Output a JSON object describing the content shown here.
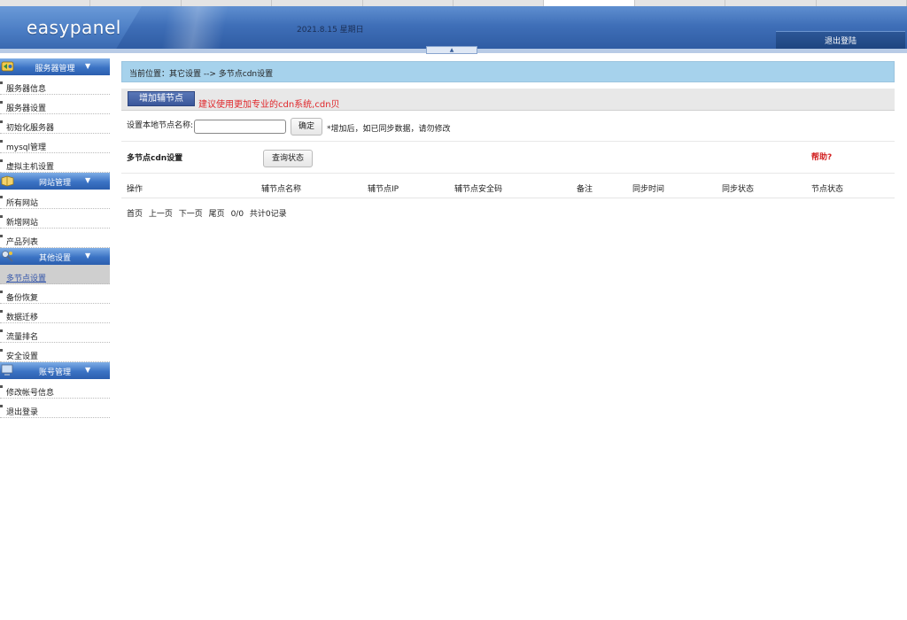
{
  "header": {
    "logo": "easypanel",
    "date": "2021.8.15 星期日",
    "logout": "退出登陆"
  },
  "sidebar": {
    "sections": [
      {
        "title": "服务器管理",
        "icon": "server-icon",
        "items": [
          "服务器信息",
          "服务器设置",
          "初始化服务器",
          "mysql管理",
          "虚拟主机设置"
        ]
      },
      {
        "title": "网站管理",
        "icon": "book-icon",
        "items": [
          "所有网站",
          "新增网站",
          "产品列表"
        ]
      },
      {
        "title": "其他设置",
        "icon": "tools-icon",
        "items": [
          "多节点设置",
          "备份恢复",
          "数据迁移",
          "流量排名",
          "安全设置"
        ],
        "active_index": 0
      },
      {
        "title": "账号管理",
        "icon": "monitor-icon",
        "items": [
          "修改帐号信息",
          "退出登录"
        ]
      }
    ]
  },
  "main": {
    "breadcrumb": "当前位置：其它设置 --> 多节点cdn设置",
    "add_button": "增加辅节点",
    "tip": "建议使用更加专业的cdn系统,cdn贝",
    "set_name_label": "设置本地节点名称:",
    "set_name_value": "",
    "ok_button": "确定",
    "note": "*增加后，如已同步数据，请勿修改",
    "multi_title": "多节点cdn设置",
    "query_button": "查询状态",
    "help": "帮助?",
    "columns": [
      "操作",
      "辅节点名称",
      "辅节点IP",
      "辅节点安全码",
      "备注",
      "同步时间",
      "同步状态",
      "节点状态"
    ],
    "pager": [
      "首页",
      "上一页",
      "下一页",
      "尾页",
      "0/0",
      "共计0记录"
    ]
  },
  "colors": {
    "header_blue": "#3f6fb8",
    "breadcrumb_bg": "#a6d2ec",
    "tip_red": "#e0262a"
  }
}
